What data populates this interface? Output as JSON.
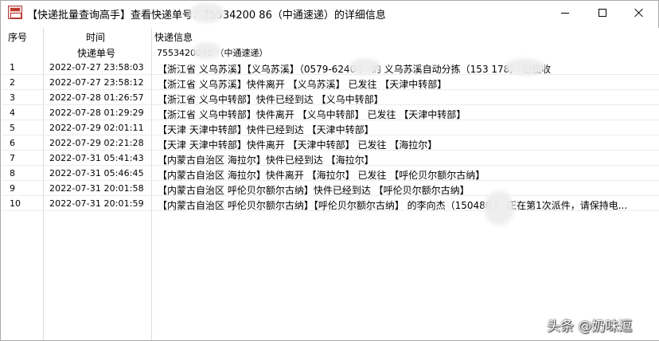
{
  "window": {
    "title": "【快递批量查询高手】查看快递单号：75534200   86（中通速递）的详细信息"
  },
  "header": {
    "seq": "序号",
    "time": "时间",
    "info": "快递信息",
    "tracking_label": "快递单号",
    "tracking_value": "7553420071    （中通速递）"
  },
  "rows": [
    {
      "seq": "1",
      "time": "2022-07-27 23:58:03",
      "info": "【浙江省 义乌苏溪】【义乌苏溪】（0579-6240     ） 的 义乌苏溪自动分拣（153      178） 已揽收"
    },
    {
      "seq": "2",
      "time": "2022-07-27 23:58:12",
      "info": "【浙江省 义乌苏溪】快件离开 【义乌苏溪】 已发往 【天津中转部】"
    },
    {
      "seq": "3",
      "time": "2022-07-28 01:26:57",
      "info": "【浙江省 义乌中转部】快件已经到达 【义乌中转部】"
    },
    {
      "seq": "4",
      "time": "2022-07-28 01:29:29",
      "info": "【浙江省 义乌中转部】快件离开 【义乌中转部】 已发往 【天津中转部】"
    },
    {
      "seq": "5",
      "time": "2022-07-29 02:01:11",
      "info": "【天津 天津中转部】快件已经到达 【天津中转部】"
    },
    {
      "seq": "6",
      "time": "2022-07-29 02:21:28",
      "info": "【天津 天津中转部】快件离开 【天津中转部】 已发往 【海拉尔】"
    },
    {
      "seq": "7",
      "time": "2022-07-31 05:41:43",
      "info": "【内蒙古自治区 海拉尔】快件已经到达 【海拉尔】"
    },
    {
      "seq": "8",
      "time": "2022-07-31 05:46:45",
      "info": "【内蒙古自治区 海拉尔】快件离开 【海拉尔】 已发往 【呼伦贝尔额尔古纳】"
    },
    {
      "seq": "9",
      "time": "2022-07-31 20:01:58",
      "info": "【内蒙古自治区 呼伦贝尔额尔古纳】快件已经到达 【呼伦贝尔额尔古纳】"
    },
    {
      "seq": "10",
      "time": "2022-07-31 20:01:59",
      "info": "【内蒙古自治区 呼伦贝尔额尔古纳】【呼伦贝尔额尔古纳】 的李向杰（150480      ） 正在第1次派件，请保持电..."
    }
  ],
  "watermark": "头条 @奶味逗"
}
